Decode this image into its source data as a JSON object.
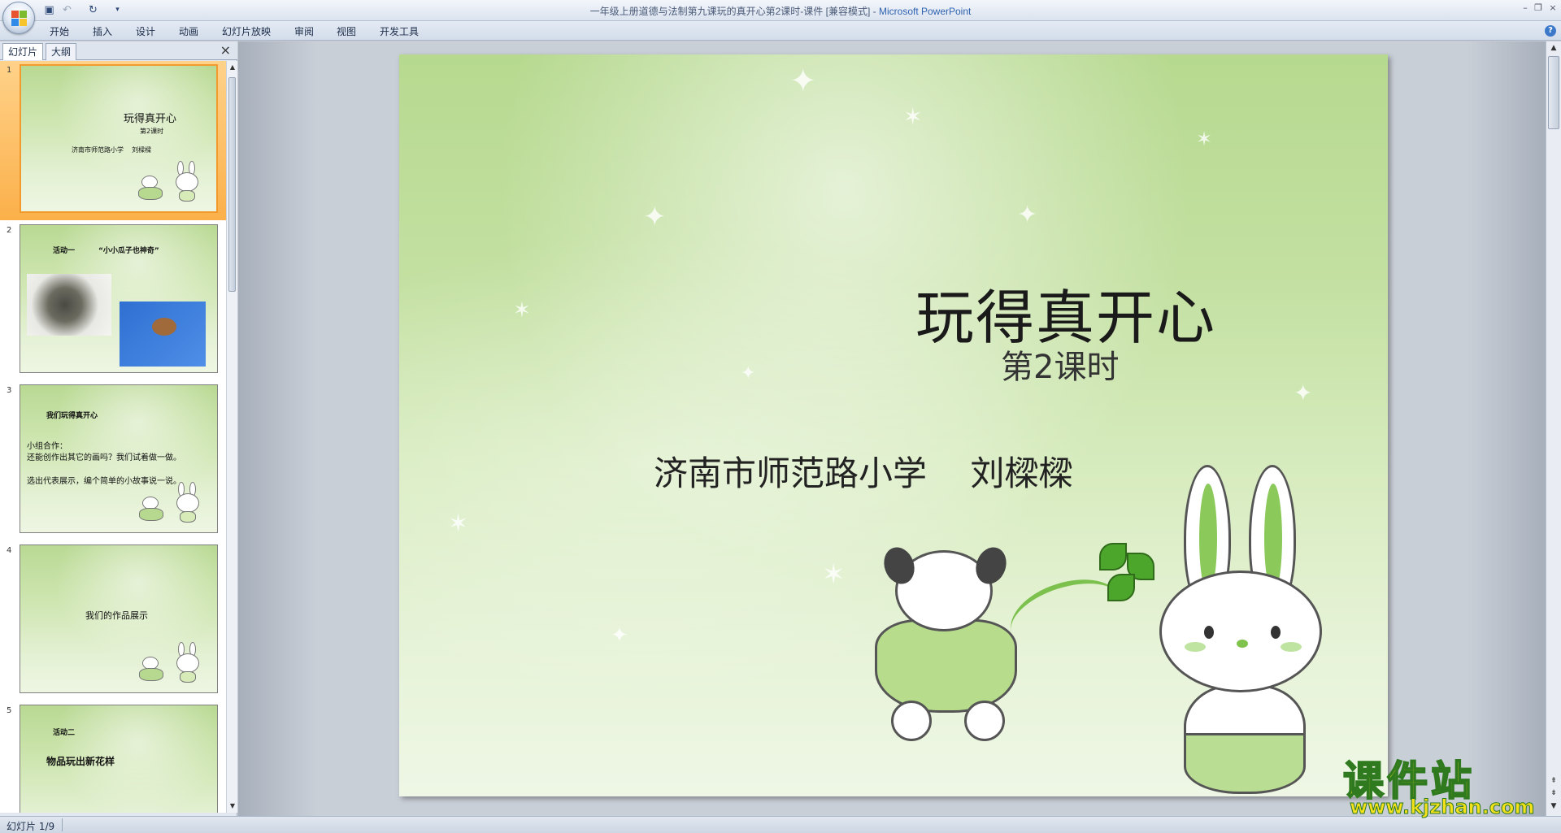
{
  "window": {
    "title": "一年级上册道德与法制第九课玩的真开心第2课时-课件 [兼容模式]",
    "title_separator": " - ",
    "app_name": "Microsoft PowerPoint",
    "controls": [
      "minimize-icon",
      "restore-icon",
      "close-icon"
    ]
  },
  "qat": {
    "icons": [
      "save-icon",
      "undo-icon",
      "redo-icon",
      "customize-icon"
    ]
  },
  "ribbon": {
    "tabs": [
      "开始",
      "插入",
      "设计",
      "动画",
      "幻灯片放映",
      "审阅",
      "视图",
      "开发工具"
    ]
  },
  "pane": {
    "tabs": [
      "幻灯片",
      "大纲"
    ],
    "close": "×"
  },
  "thumbnails": [
    {
      "num": "1",
      "title": "玩得真开心",
      "subtitle": "第2课时",
      "body": "济南市师范路小学    刘樑樑"
    },
    {
      "num": "2",
      "title": "活动一",
      "quote": "“小小瓜子也神奇”"
    },
    {
      "num": "3",
      "title": "我们玩得真开心",
      "line1": "小组合作：",
      "line2": "还能创作出其它的画吗？我们试着做一做。",
      "line3": "选出代表展示，编个简单的小故事说一说。"
    },
    {
      "num": "4",
      "title": "我们的作品展示"
    },
    {
      "num": "5",
      "title": "活动二",
      "subtitle": "物品玩出新花样"
    }
  ],
  "slide": {
    "title": "玩得真开心",
    "subtitle": "第2课时",
    "school_author": "济南市师范路小学    刘樑樑"
  },
  "watermark": {
    "text": "课件站",
    "url": "www.kjzhan.com"
  },
  "status": {
    "slide_indicator": "幻灯片 1/9"
  },
  "colors": {
    "accent": "#2f62b0",
    "selected_thumb": "#f29a2e",
    "slide_green": "#b6d98f"
  }
}
